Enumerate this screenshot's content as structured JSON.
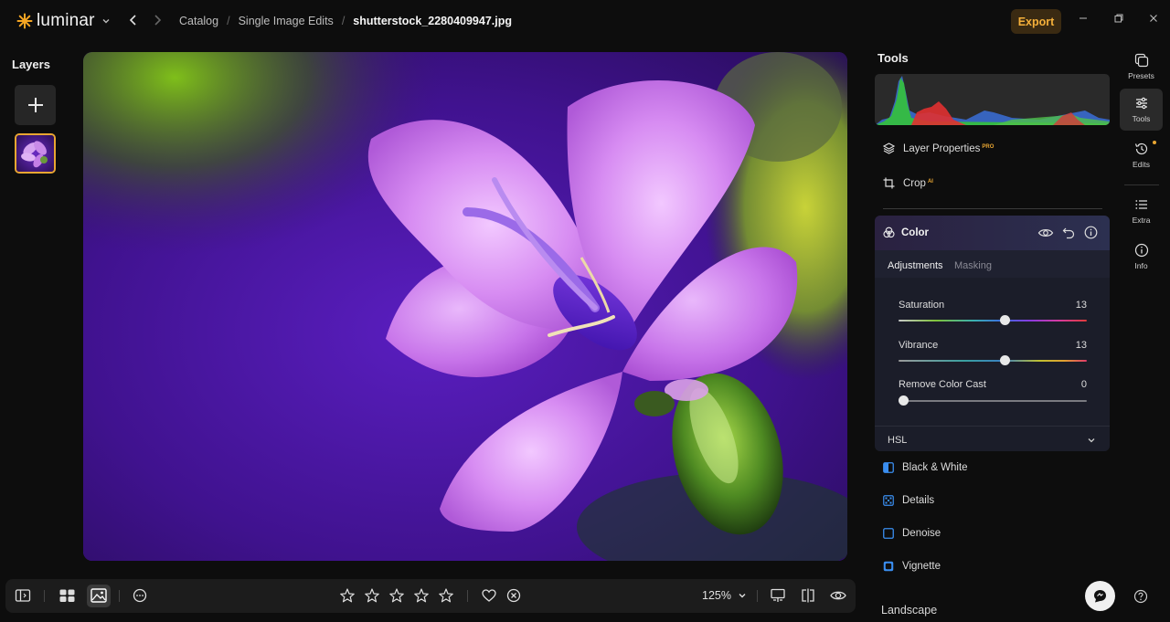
{
  "app": {
    "name": "luminar",
    "export_label": "Export"
  },
  "breadcrumb": {
    "items": [
      "Catalog",
      "Single Image Edits"
    ],
    "current": "shutterstock_2280409947.jpg"
  },
  "layers": {
    "title": "Layers"
  },
  "tools": {
    "title": "Tools",
    "layer_properties": "Layer Properties",
    "layer_properties_badge": "PRO",
    "crop": "Crop",
    "crop_badge": "AI"
  },
  "color_panel": {
    "title": "Color",
    "tabs": [
      "Adjustments",
      "Masking"
    ],
    "active_tab": "Adjustments",
    "sliders": [
      {
        "label": "Saturation",
        "value": "13",
        "position": 0.565
      },
      {
        "label": "Vibrance",
        "value": "13",
        "position": 0.565
      },
      {
        "label": "Remove Color Cast",
        "value": "0",
        "position": 0.0
      }
    ],
    "hsl_label": "HSL"
  },
  "tool_list": [
    {
      "label": "Black & White",
      "icon": "black-white-icon"
    },
    {
      "label": "Details",
      "icon": "details-icon"
    },
    {
      "label": "Denoise",
      "icon": "denoise-icon"
    },
    {
      "label": "Vignette",
      "icon": "vignette-icon"
    }
  ],
  "section_landscape": "Landscape",
  "rail": [
    {
      "label": "Presets",
      "icon": "presets-icon"
    },
    {
      "label": "Tools",
      "icon": "tools-icon"
    },
    {
      "label": "Edits",
      "icon": "edits-icon"
    },
    {
      "label": "Extra",
      "icon": "extra-icon"
    },
    {
      "label": "Info",
      "icon": "info-icon"
    }
  ],
  "bottombar": {
    "zoom": "125%",
    "rating_max": 5
  },
  "colors": {
    "accent": "#e9a632",
    "export_text": "#f5b03a",
    "panel_bg": "#181a24"
  }
}
